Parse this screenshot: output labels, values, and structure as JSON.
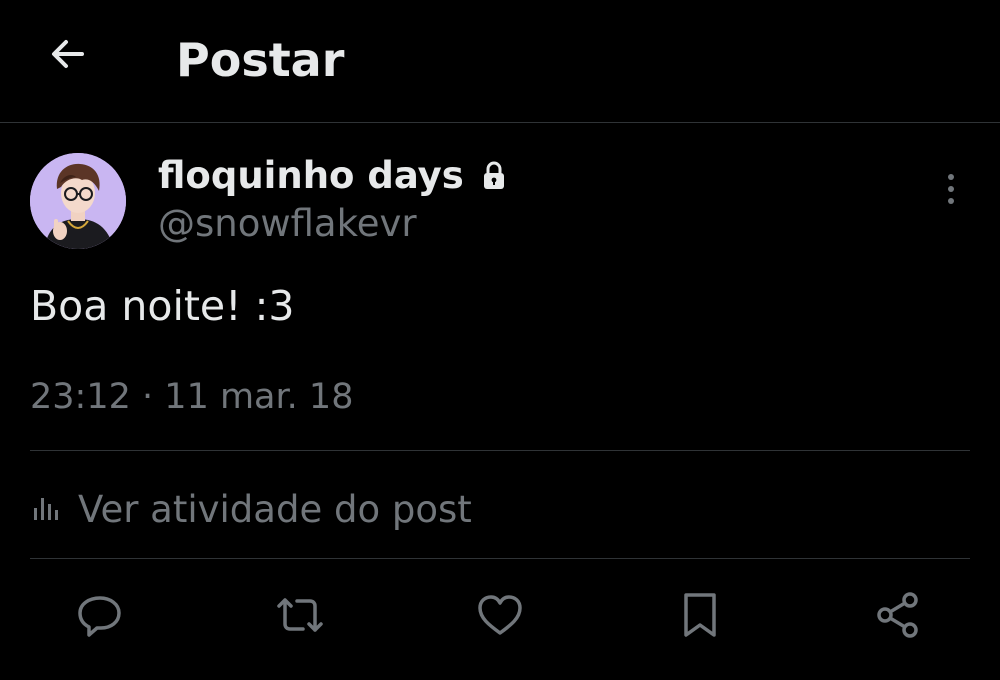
{
  "header": {
    "title": "Postar",
    "back_icon": "arrow-left-icon"
  },
  "post": {
    "author": {
      "display_name": "floquinho days",
      "handle": "@snowflakevr",
      "protected_icon": "lock-icon",
      "avatar_bg": "#c9b6f2"
    },
    "text": "Boa noite! :3",
    "time": "23:12",
    "separator": "·",
    "date": "11 mar. 18",
    "activity_label": "Ver atividade do post",
    "activity_icon": "bar-chart-icon",
    "more_icon": "more-vertical-icon"
  },
  "actions": [
    {
      "icon": "reply-icon"
    },
    {
      "icon": "repost-icon"
    },
    {
      "icon": "like-icon"
    },
    {
      "icon": "bookmark-icon"
    },
    {
      "icon": "share-icon"
    }
  ],
  "colors": {
    "background": "#000000",
    "primary_text": "#e7e9ea",
    "secondary_text": "#71767b",
    "divider": "#2f3336"
  }
}
